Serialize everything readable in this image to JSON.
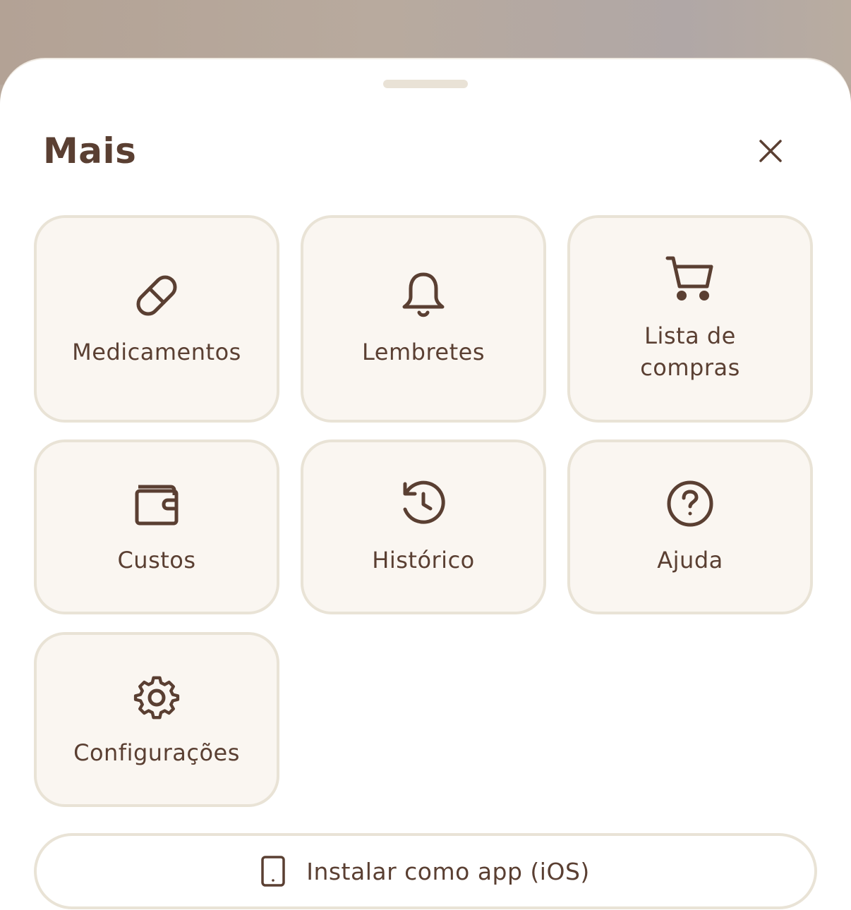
{
  "sheet": {
    "title": "Mais",
    "close_icon": "close-icon"
  },
  "tiles": [
    {
      "label": "Medicamentos",
      "icon": "pill-icon"
    },
    {
      "label": "Lembretes",
      "icon": "bell-icon"
    },
    {
      "label": "Lista de\ncompras",
      "icon": "cart-icon"
    },
    {
      "label": "Custos",
      "icon": "wallet-icon"
    },
    {
      "label": "Histórico",
      "icon": "history-icon"
    },
    {
      "label": "Ajuda",
      "icon": "help-circle-icon"
    },
    {
      "label": "Configurações",
      "icon": "gear-icon"
    }
  ],
  "install": {
    "label": "Instalar como app (iOS)",
    "icon": "smartphone-icon"
  },
  "colors": {
    "text": "#5a3f32",
    "tile_bg": "#faf6f1",
    "tile_border": "#e9e3d6",
    "backdrop": "#b7a89c"
  }
}
